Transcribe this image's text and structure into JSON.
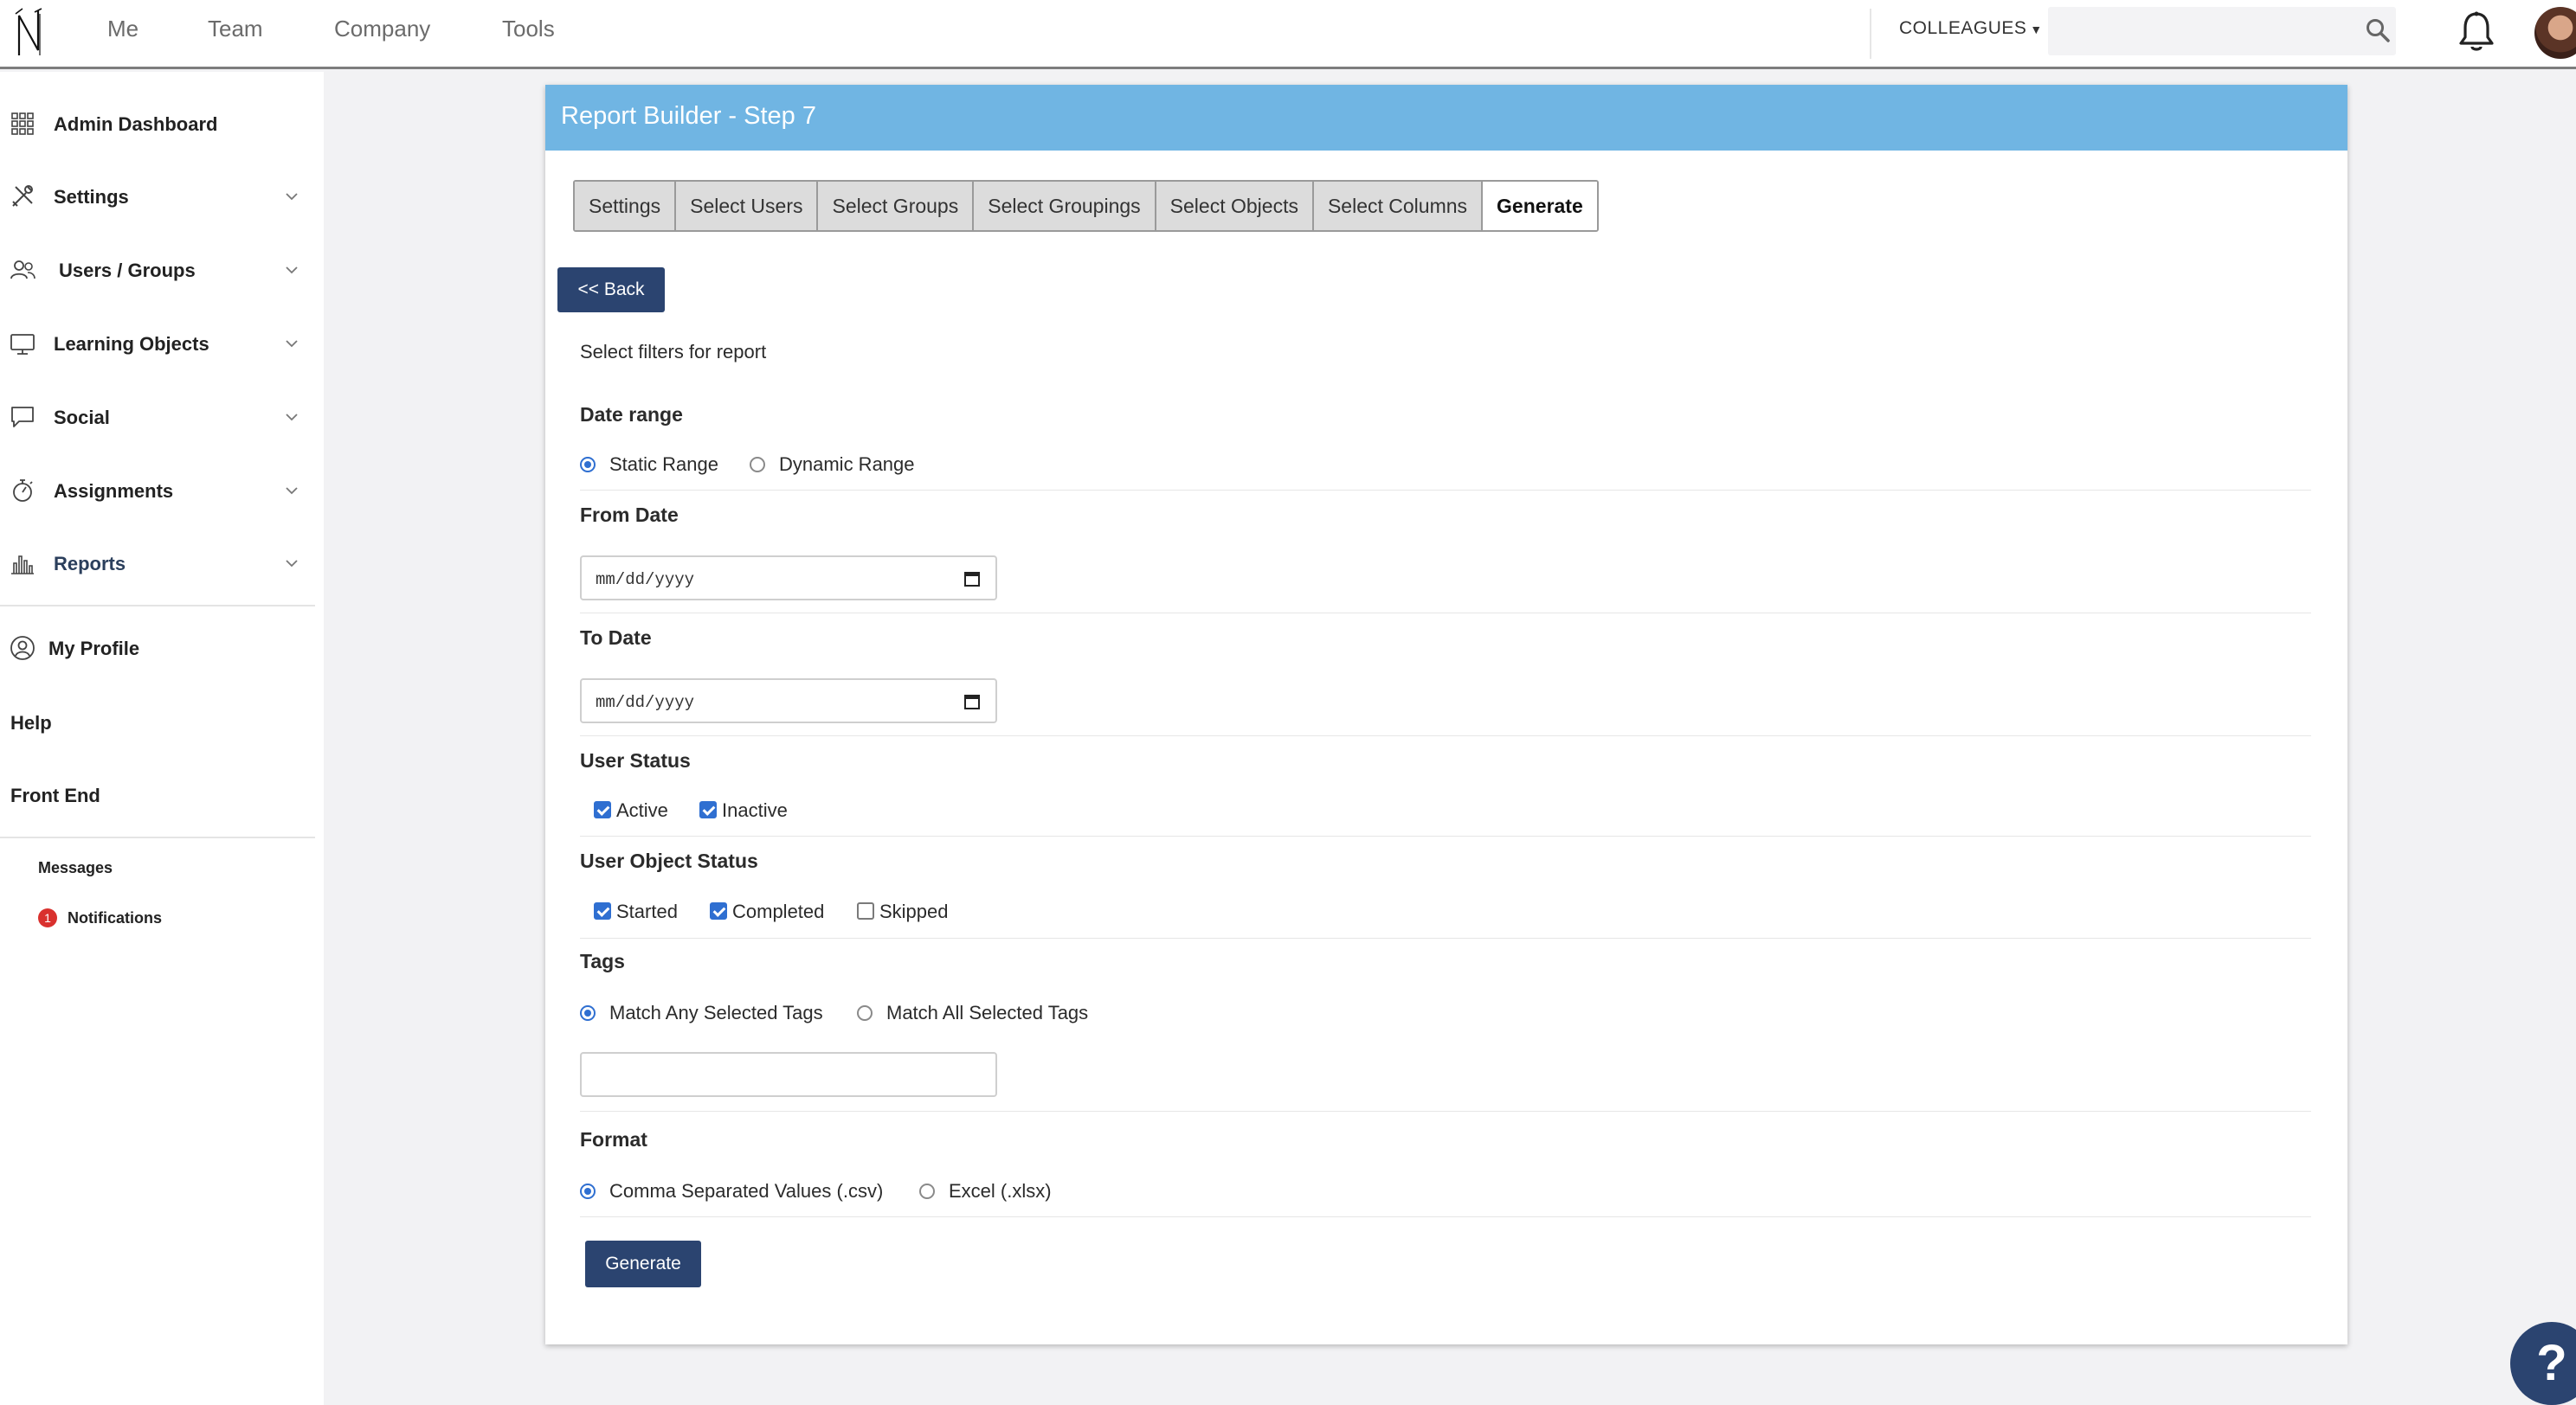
{
  "topbar": {
    "nav": [
      "Me",
      "Team",
      "Company",
      "Tools"
    ],
    "colleagues_label": "COLLEAGUES",
    "search_placeholder": "",
    "icons": [
      "logo-icon",
      "search-icon",
      "bell-icon",
      "avatar"
    ]
  },
  "sidebar": {
    "items": [
      {
        "label": "Admin Dashboard",
        "icon": "grid-icon"
      },
      {
        "label": "Settings",
        "icon": "tools-icon"
      },
      {
        "label": "Users / Groups",
        "icon": "users-icon"
      },
      {
        "label": "Learning Objects",
        "icon": "monitor-icon"
      },
      {
        "label": "Social",
        "icon": "speech-bubble-icon"
      },
      {
        "label": "Assignments",
        "icon": "stopwatch-icon"
      },
      {
        "label": "Reports",
        "icon": "bar-chart-icon"
      }
    ],
    "profile": "My Profile",
    "help": "Help",
    "front_end": "Front End",
    "messages": "Messages",
    "notifications": "Notifications",
    "notification_count": "1"
  },
  "panel": {
    "title": "Report Builder - Step 7",
    "tabs": [
      "Settings",
      "Select Users",
      "Select Groups",
      "Select Groupings",
      "Select Objects",
      "Select Columns",
      "Generate"
    ],
    "active_tab": "Generate",
    "back_label": "<< Back",
    "intro": "Select filters for report",
    "date_range": {
      "label": "Date range",
      "options": [
        "Static Range",
        "Dynamic Range"
      ],
      "selected": "Static Range"
    },
    "from_date": {
      "label": "From Date",
      "value": "mm/dd/yyyy"
    },
    "to_date": {
      "label": "To Date",
      "value": "mm/dd/yyyy"
    },
    "user_status": {
      "label": "User Status",
      "options": [
        {
          "label": "Active",
          "checked": true
        },
        {
          "label": "Inactive",
          "checked": true
        }
      ]
    },
    "user_object_status": {
      "label": "User Object Status",
      "options": [
        {
          "label": "Started",
          "checked": true
        },
        {
          "label": "Completed",
          "checked": true
        },
        {
          "label": "Skipped",
          "checked": false
        }
      ]
    },
    "tags": {
      "label": "Tags",
      "options": [
        "Match Any Selected Tags",
        "Match All Selected Tags"
      ],
      "selected": "Match Any Selected Tags",
      "input_value": ""
    },
    "format": {
      "label": "Format",
      "options": [
        "Comma Separated Values (.csv)",
        "Excel (.xlsx)"
      ],
      "selected": "Comma Separated Values (.csv)"
    },
    "generate_label": "Generate"
  },
  "help_button": "?",
  "colors": {
    "header_blue": "#70b5e3",
    "button_navy": "#2b4470",
    "radio_blue": "#2f6fd1",
    "badge_red": "#d9312e"
  }
}
